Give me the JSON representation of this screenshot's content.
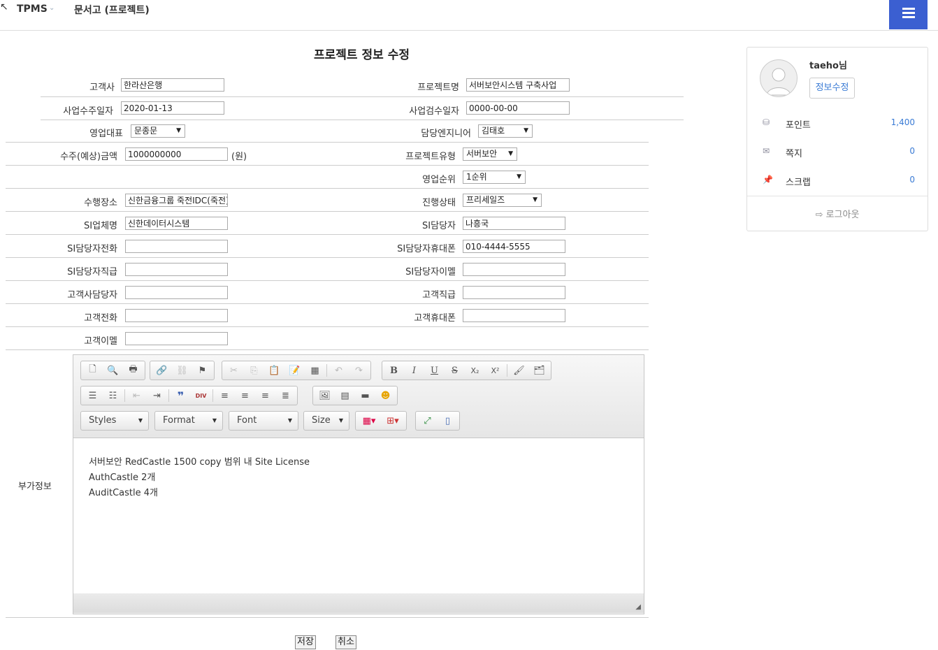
{
  "header": {
    "brand": "TPMS",
    "brand_caret": "⌄",
    "breadcrumb": "문서고 (프로젝트)"
  },
  "form": {
    "title": "프로젝트 정보 수정",
    "labels": {
      "customer": "고객사",
      "project_name": "프로젝트명",
      "order_date": "사업수주일자",
      "inspection_date": "사업검수일자",
      "sales_rep": "영업대표",
      "engineer": "담당엔지니어",
      "amount": "수주(예상)금액",
      "amount_unit": "(원)",
      "project_type": "프로젝트유형",
      "sales_rank": "영업순위",
      "location": "수행장소",
      "progress": "진행상태",
      "si_company": "SI업체명",
      "si_manager": "SI담당자",
      "si_phone": "SI담당자전화",
      "si_mobile": "SI담당자휴대폰",
      "si_position": "SI담당자직급",
      "si_email": "SI담당자이멜",
      "cust_manager": "고객사담당자",
      "cust_position": "고객직급",
      "cust_phone": "고객전화",
      "cust_mobile": "고객휴대폰",
      "cust_email": "고객이멜",
      "extra": "부가정보"
    },
    "values": {
      "customer": "한라산은행",
      "project_name": "서버보안시스템 구축사업",
      "order_date": "2020-01-13",
      "inspection_date": "0000-00-00",
      "sales_rep": "문종문",
      "engineer": "김태호",
      "amount": "1000000000",
      "project_type": "서버보안",
      "sales_rank": "1순위",
      "location": "신한금융그룹 죽전IDC(죽전)",
      "progress": "프리세일즈",
      "si_company": "신한데이터시스템",
      "si_manager": "나흥국",
      "si_phone": "",
      "si_mobile": "010-4444-5555",
      "si_position": "",
      "si_email": "",
      "cust_manager": "",
      "cust_position": "",
      "cust_phone": "",
      "cust_mobile": "",
      "cust_email": ""
    }
  },
  "editor": {
    "combos": {
      "styles": "Styles",
      "format": "Format",
      "font": "Font",
      "size": "Size"
    },
    "toolbar_icons": {
      "bold": "B",
      "italic": "I",
      "underline": "U",
      "strike": "S",
      "subscript": "X₂",
      "superscript": "X²",
      "blockquote": "❞",
      "div": "DIV"
    },
    "content": [
      "서버보안 RedCastle 1500 copy 범위 내 Site License",
      "AuthCastle 2개",
      "AuditCastle 4개"
    ]
  },
  "buttons": {
    "save": "저장",
    "cancel": "취소"
  },
  "profile": {
    "username": "taeho님",
    "edit_label": "정보수정",
    "points_label": "포인트",
    "points_value": "1,400",
    "memo_label": "쪽지",
    "memo_value": "0",
    "scrap_label": "스크랩",
    "scrap_value": "0",
    "logout_label": "로그아웃"
  },
  "colors": {
    "accent": "#3b5fd1",
    "link": "#3a7bd5"
  }
}
